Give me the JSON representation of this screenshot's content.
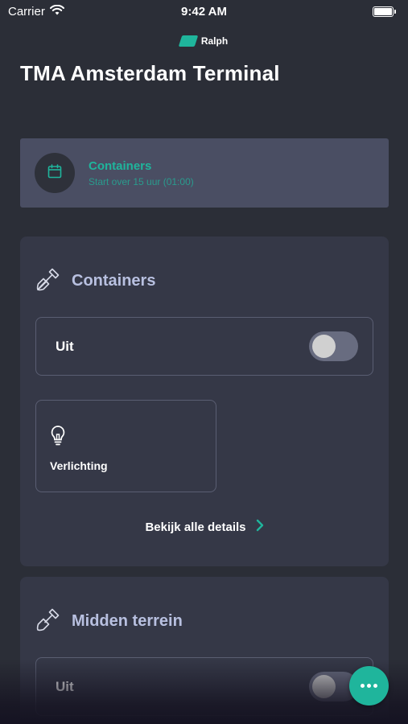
{
  "status_bar": {
    "carrier": "Carrier",
    "time": "9:42 AM",
    "wifi_icon": "wifi-icon",
    "battery_icon": "battery-icon"
  },
  "brand": {
    "name": "Ralph",
    "logo_icon": "ralph-logo-icon"
  },
  "page": {
    "title": "TMA Amsterdam Terminal"
  },
  "schedule": {
    "icon": "calendar-icon",
    "title": "Containers",
    "subtitle": "Start over 15 uur (01:00)"
  },
  "zones": [
    {
      "icon": "shovel-icon",
      "title": "Containers",
      "toggle_label": "Uit",
      "toggle_on": false,
      "tiles": [
        {
          "icon": "lightbulb-icon",
          "label": "Verlichting"
        }
      ],
      "details_label": "Bekijk alle details"
    },
    {
      "icon": "shovel-icon",
      "title": "Midden terrein",
      "toggle_label": "Uit",
      "toggle_on": false
    }
  ],
  "fab": {
    "icon": "more-icon"
  },
  "colors": {
    "background": "#2b2e37",
    "card": "#353847",
    "schedule_card": "#4a4e63",
    "accent": "#1fb59c",
    "zone_title": "#b8c0e0"
  }
}
